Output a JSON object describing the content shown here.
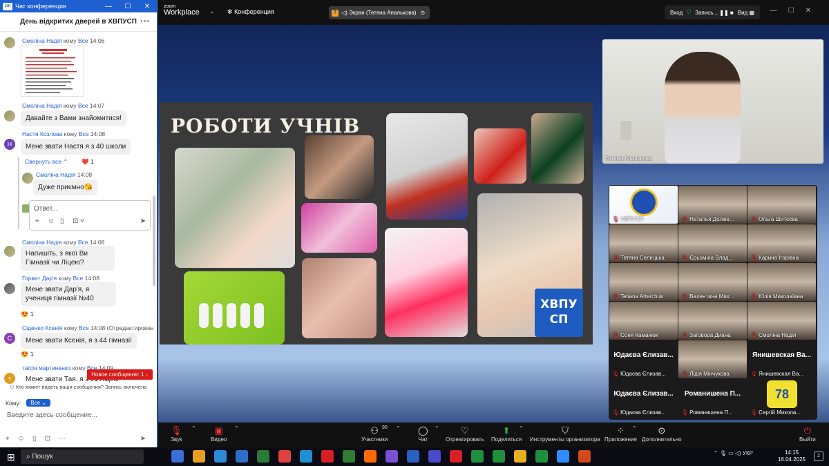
{
  "chat_window": {
    "title": "Чат конференции",
    "app_badge": "zm",
    "header": "День відкритих дверей в ХВПУСП",
    "messages": [
      {
        "sender": "Смоліна Надія",
        "to_label": "кому",
        "to": "Все",
        "time": "14:06",
        "text": "",
        "attachment": true,
        "avatar": "photo"
      },
      {
        "sender": "Смоліна Надія",
        "to_label": "кому",
        "to": "Все",
        "time": "14:07",
        "text": "Давайте з Вами знайомитися!",
        "avatar": "photo"
      },
      {
        "sender": "Настя Козлова",
        "to_label": "кому",
        "to": "Все",
        "time": "14:08",
        "text": "Мене звати Настя я з 40 школи",
        "avatar": "Н",
        "avatar_color": "#6a3fb5"
      },
      {
        "sender": "Смоліна Надія",
        "to_label": "кому",
        "to": "Все",
        "time": "14:08",
        "text": "Напишіть, з якої Ви Гімназії чи Ліцею?",
        "avatar": "photo"
      },
      {
        "sender": "Горват Дар'я",
        "to_label": "кому",
        "to": "Все",
        "time": "14:08",
        "text": "Мене звати Дар'я, я учениця гімназії №40",
        "avatar": "photo",
        "reaction": "😍 1"
      },
      {
        "sender": "Сіденко Ксенія",
        "to_label": "кому",
        "to": "Все",
        "time": "14:08 (Отредактировано)",
        "text": "Мене звати Ксенія, я з 44 гімназії",
        "avatar": "С",
        "avatar_color": "#8a3fb5",
        "reaction": "😍 1"
      },
      {
        "sender": "таїсія мартиненко",
        "to_label": "кому",
        "to": "Все",
        "time": "14:09",
        "text": "Мене звати Тая. я з 91 Ліцею",
        "avatar": "т",
        "avatar_color": "#e09b20"
      }
    ],
    "thread": {
      "collapse_label": "Свернуть все",
      "reaction": "❤️ 1",
      "reply_sender": "Смоліна Надія",
      "reply_time": "14:08",
      "reply_text": "Дуже приємно😘",
      "reply_placeholder": "Ответ..."
    },
    "new_messages_label": "Новое сообщение: 1",
    "visibility_text": "Кто может видеть ваши сообщения? Запись включена",
    "to_label": "Кому:",
    "to_value": "Все",
    "compose_placeholder": "Введите здесь сообщение..."
  },
  "zoom": {
    "brand_small": "zoom",
    "brand_name": "Workplace",
    "meeting_label": "Конференция",
    "screen_share_label": "Экран (Тетяна Апалькова)",
    "top_right": {
      "login": "Вход",
      "record": "Запись...",
      "view": "Вид"
    },
    "slide": {
      "title": "РОБОТИ УЧНІВ",
      "logo_line1": "ХВПУ",
      "logo_line2": "СП"
    },
    "speaker_name": "Тетяна Апалькова",
    "video_tiles": [
      {
        "name": "ХВПУСП",
        "kind": "logo"
      },
      {
        "name": "Наталья Долже...",
        "kind": "video"
      },
      {
        "name": "Ольга Шитєєва",
        "kind": "video"
      },
      {
        "name": "Тетяна Селецька",
        "kind": "video"
      },
      {
        "name": "Єрьоміна Влад...",
        "kind": "video"
      },
      {
        "name": "Карина Ігорівна",
        "kind": "video"
      },
      {
        "name": "Tetiana Arterchuk",
        "kind": "video"
      },
      {
        "name": "Валентина Мих...",
        "kind": "video"
      },
      {
        "name": "Юлія Миколаївна",
        "kind": "video"
      },
      {
        "name": "Соня Каманюк",
        "kind": "video"
      },
      {
        "name": "Заговора Диана",
        "kind": "video"
      },
      {
        "name": "Смоліна Надія",
        "kind": "video"
      },
      {
        "name": "Юдаєва Єлизав...",
        "kind": "text",
        "big": "Юдаєва Єлизав..."
      },
      {
        "name": "Лідія Мінчукова",
        "kind": "video"
      },
      {
        "name": "Янишевская Ва...",
        "kind": "text",
        "big": "Янишевская Ва..."
      },
      {
        "name": "Юдаєва Єлизав...",
        "kind": "text",
        "big": "Юдаєва Єлизав..."
      },
      {
        "name": "Романишена П...",
        "kind": "text",
        "big": "Романишена П..."
      },
      {
        "name": "Сергій Миколa...",
        "kind": "badge",
        "badge": "78"
      }
    ],
    "toolbar": {
      "audio": "Звук",
      "video": "Видео",
      "participants": "Участники",
      "participants_count": "90",
      "chat": "Чат",
      "react": "Отреагировать",
      "share": "Поделиться",
      "host_tools": "Инструменты организатора",
      "apps": "Приложения",
      "more": "Дополнительно",
      "leave": "Выйти"
    }
  },
  "taskbar": {
    "search": "Пошук",
    "lang": "УКР",
    "time": "14:15",
    "date": "16.04.2025",
    "notifications": "2"
  }
}
